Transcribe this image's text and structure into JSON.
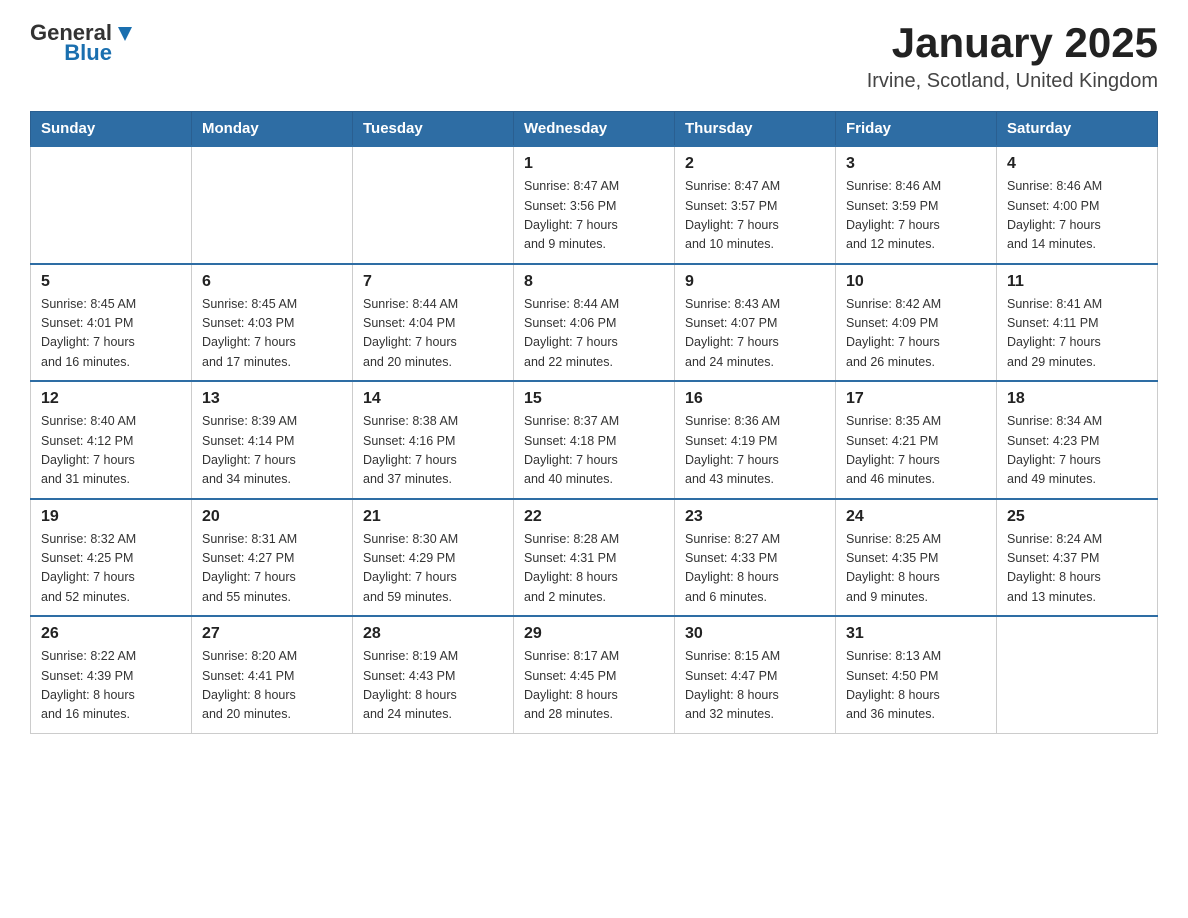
{
  "header": {
    "logo_general": "General",
    "logo_blue": "Blue",
    "title": "January 2025",
    "subtitle": "Irvine, Scotland, United Kingdom"
  },
  "days_of_week": [
    "Sunday",
    "Monday",
    "Tuesday",
    "Wednesday",
    "Thursday",
    "Friday",
    "Saturday"
  ],
  "weeks": [
    [
      {
        "day": "",
        "info": ""
      },
      {
        "day": "",
        "info": ""
      },
      {
        "day": "",
        "info": ""
      },
      {
        "day": "1",
        "info": "Sunrise: 8:47 AM\nSunset: 3:56 PM\nDaylight: 7 hours\nand 9 minutes."
      },
      {
        "day": "2",
        "info": "Sunrise: 8:47 AM\nSunset: 3:57 PM\nDaylight: 7 hours\nand 10 minutes."
      },
      {
        "day": "3",
        "info": "Sunrise: 8:46 AM\nSunset: 3:59 PM\nDaylight: 7 hours\nand 12 minutes."
      },
      {
        "day": "4",
        "info": "Sunrise: 8:46 AM\nSunset: 4:00 PM\nDaylight: 7 hours\nand 14 minutes."
      }
    ],
    [
      {
        "day": "5",
        "info": "Sunrise: 8:45 AM\nSunset: 4:01 PM\nDaylight: 7 hours\nand 16 minutes."
      },
      {
        "day": "6",
        "info": "Sunrise: 8:45 AM\nSunset: 4:03 PM\nDaylight: 7 hours\nand 17 minutes."
      },
      {
        "day": "7",
        "info": "Sunrise: 8:44 AM\nSunset: 4:04 PM\nDaylight: 7 hours\nand 20 minutes."
      },
      {
        "day": "8",
        "info": "Sunrise: 8:44 AM\nSunset: 4:06 PM\nDaylight: 7 hours\nand 22 minutes."
      },
      {
        "day": "9",
        "info": "Sunrise: 8:43 AM\nSunset: 4:07 PM\nDaylight: 7 hours\nand 24 minutes."
      },
      {
        "day": "10",
        "info": "Sunrise: 8:42 AM\nSunset: 4:09 PM\nDaylight: 7 hours\nand 26 minutes."
      },
      {
        "day": "11",
        "info": "Sunrise: 8:41 AM\nSunset: 4:11 PM\nDaylight: 7 hours\nand 29 minutes."
      }
    ],
    [
      {
        "day": "12",
        "info": "Sunrise: 8:40 AM\nSunset: 4:12 PM\nDaylight: 7 hours\nand 31 minutes."
      },
      {
        "day": "13",
        "info": "Sunrise: 8:39 AM\nSunset: 4:14 PM\nDaylight: 7 hours\nand 34 minutes."
      },
      {
        "day": "14",
        "info": "Sunrise: 8:38 AM\nSunset: 4:16 PM\nDaylight: 7 hours\nand 37 minutes."
      },
      {
        "day": "15",
        "info": "Sunrise: 8:37 AM\nSunset: 4:18 PM\nDaylight: 7 hours\nand 40 minutes."
      },
      {
        "day": "16",
        "info": "Sunrise: 8:36 AM\nSunset: 4:19 PM\nDaylight: 7 hours\nand 43 minutes."
      },
      {
        "day": "17",
        "info": "Sunrise: 8:35 AM\nSunset: 4:21 PM\nDaylight: 7 hours\nand 46 minutes."
      },
      {
        "day": "18",
        "info": "Sunrise: 8:34 AM\nSunset: 4:23 PM\nDaylight: 7 hours\nand 49 minutes."
      }
    ],
    [
      {
        "day": "19",
        "info": "Sunrise: 8:32 AM\nSunset: 4:25 PM\nDaylight: 7 hours\nand 52 minutes."
      },
      {
        "day": "20",
        "info": "Sunrise: 8:31 AM\nSunset: 4:27 PM\nDaylight: 7 hours\nand 55 minutes."
      },
      {
        "day": "21",
        "info": "Sunrise: 8:30 AM\nSunset: 4:29 PM\nDaylight: 7 hours\nand 59 minutes."
      },
      {
        "day": "22",
        "info": "Sunrise: 8:28 AM\nSunset: 4:31 PM\nDaylight: 8 hours\nand 2 minutes."
      },
      {
        "day": "23",
        "info": "Sunrise: 8:27 AM\nSunset: 4:33 PM\nDaylight: 8 hours\nand 6 minutes."
      },
      {
        "day": "24",
        "info": "Sunrise: 8:25 AM\nSunset: 4:35 PM\nDaylight: 8 hours\nand 9 minutes."
      },
      {
        "day": "25",
        "info": "Sunrise: 8:24 AM\nSunset: 4:37 PM\nDaylight: 8 hours\nand 13 minutes."
      }
    ],
    [
      {
        "day": "26",
        "info": "Sunrise: 8:22 AM\nSunset: 4:39 PM\nDaylight: 8 hours\nand 16 minutes."
      },
      {
        "day": "27",
        "info": "Sunrise: 8:20 AM\nSunset: 4:41 PM\nDaylight: 8 hours\nand 20 minutes."
      },
      {
        "day": "28",
        "info": "Sunrise: 8:19 AM\nSunset: 4:43 PM\nDaylight: 8 hours\nand 24 minutes."
      },
      {
        "day": "29",
        "info": "Sunrise: 8:17 AM\nSunset: 4:45 PM\nDaylight: 8 hours\nand 28 minutes."
      },
      {
        "day": "30",
        "info": "Sunrise: 8:15 AM\nSunset: 4:47 PM\nDaylight: 8 hours\nand 32 minutes."
      },
      {
        "day": "31",
        "info": "Sunrise: 8:13 AM\nSunset: 4:50 PM\nDaylight: 8 hours\nand 36 minutes."
      },
      {
        "day": "",
        "info": ""
      }
    ]
  ]
}
